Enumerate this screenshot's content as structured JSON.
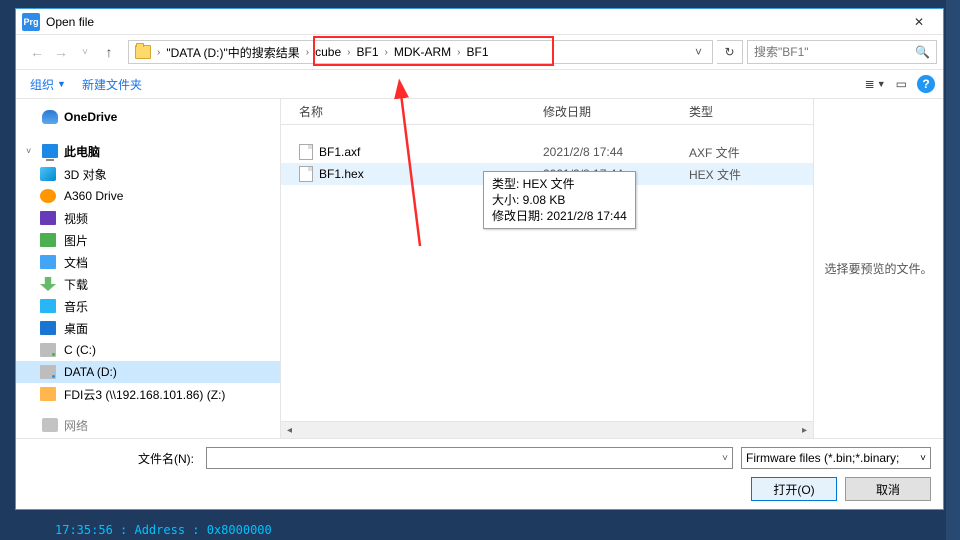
{
  "window": {
    "title": "Open file",
    "app_badge": "Prg"
  },
  "address": {
    "root": "\"DATA (D:)\"中的搜索结果",
    "crumbs": [
      "cube",
      "BF1",
      "MDK-ARM",
      "BF1"
    ]
  },
  "search": {
    "placeholder": "搜索\"BF1\""
  },
  "toolbar": {
    "organize": "组织",
    "new_folder": "新建文件夹"
  },
  "sidebar": {
    "onedrive": "OneDrive",
    "this_pc": "此电脑",
    "items": [
      "3D 对象",
      "A360 Drive",
      "视频",
      "图片",
      "文档",
      "下载",
      "音乐",
      "桌面",
      "C (C:)",
      "DATA (D:)",
      "FDI云3 (\\\\192.168.101.86) (Z:)"
    ],
    "network_caret": "网络"
  },
  "columns": {
    "name": "名称",
    "date": "修改日期",
    "type": "类型"
  },
  "files": [
    {
      "name": "BF1.axf",
      "date": "2021/2/8 17:44",
      "type": "AXF 文件"
    },
    {
      "name": "BF1.hex",
      "date": "2021/2/8 17:44",
      "type": "HEX 文件"
    }
  ],
  "tooltip": {
    "line1": "类型: HEX 文件",
    "line2": "大小: 9.08 KB",
    "line3": "修改日期: 2021/2/8 17:44"
  },
  "preview": {
    "text": "选择要预览的文件。"
  },
  "footer": {
    "filename_label": "文件名(N):",
    "filter": "Firmware files (*.bin;*.binary;",
    "open": "打开(O)",
    "cancel": "取消"
  },
  "log": "17:35:56 : Address : 0x8000000"
}
